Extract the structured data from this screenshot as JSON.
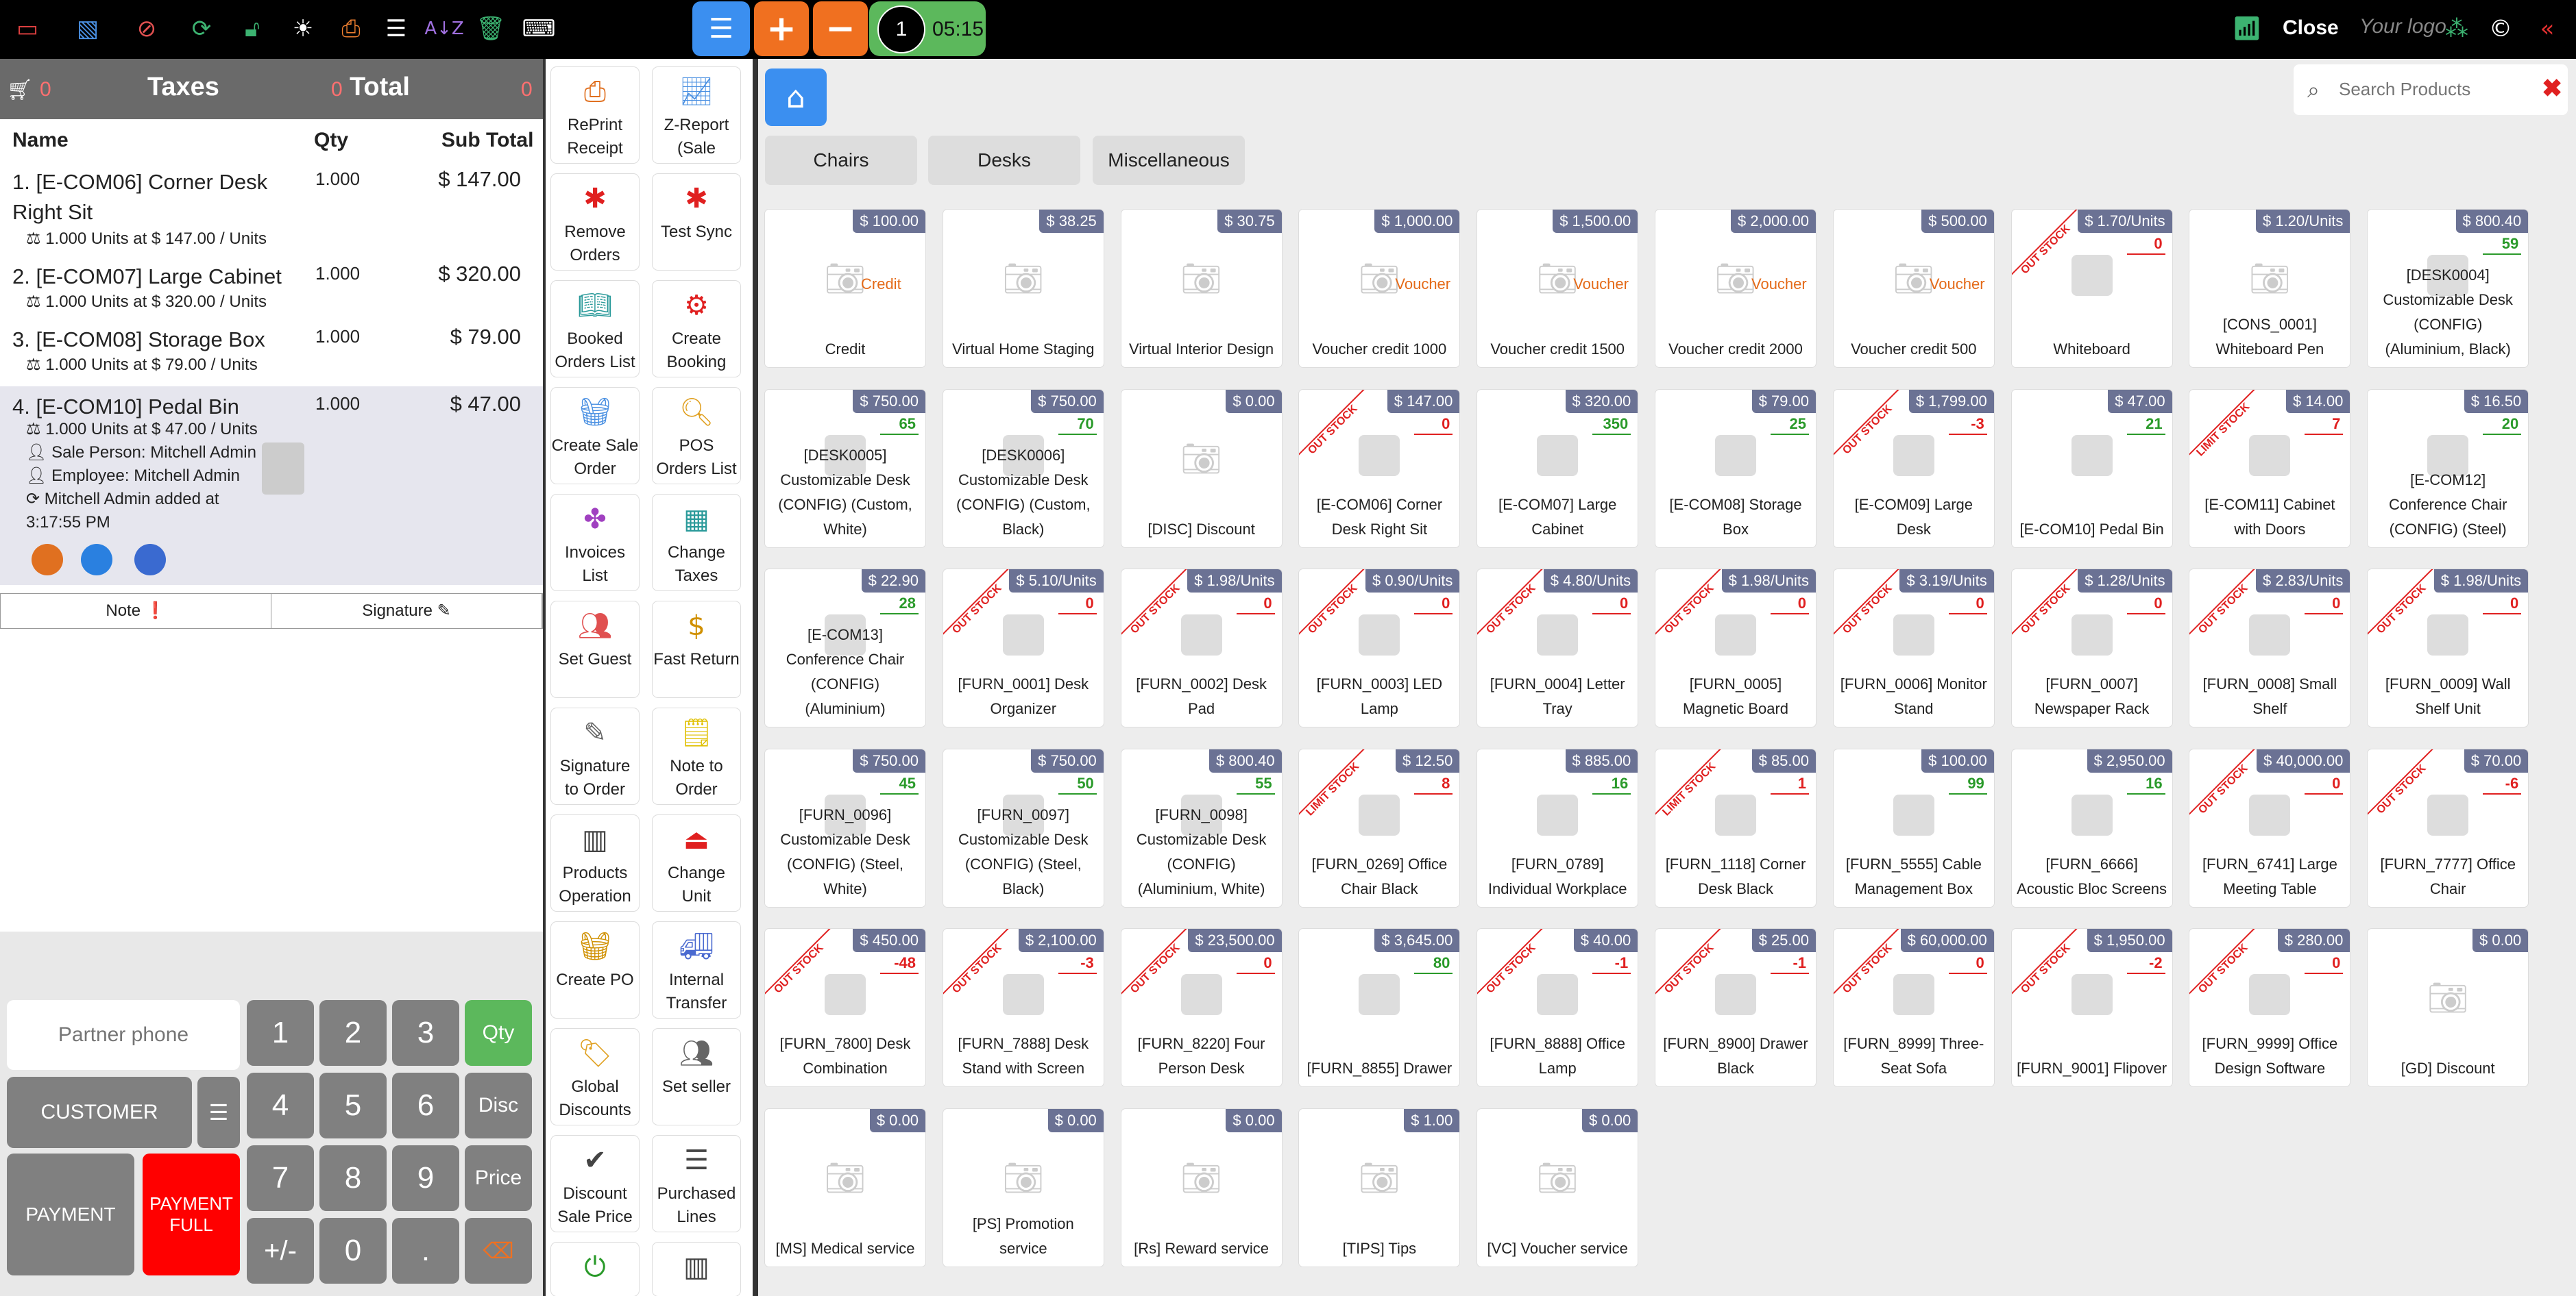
{
  "topbar": {
    "icons": [
      "monitor-icon",
      "image-icon",
      "cancel-icon",
      "refresh-icon",
      "unlock-icon",
      "bulb-icon",
      "print-icon",
      "list-icon",
      "sort-az-icon",
      "trash-icon",
      "keyboard-icon"
    ],
    "plus": "+",
    "minus": "−",
    "order_number": "1",
    "timer": "05:15",
    "close_label": "Close",
    "logo_text": "Your logo"
  },
  "order": {
    "header_taxes": "Taxes",
    "header_total": "Total",
    "header_zero": "0",
    "col_name": "Name",
    "col_qty": "Qty",
    "col_subtotal": "Sub Total",
    "lines": [
      {
        "name": "1. [E-COM06] Corner Desk Right Sit",
        "qty": "1.000",
        "subtotal": "$ 147.00",
        "detail": "1.000 Units at $ 147.00 / Units"
      },
      {
        "name": "2. [E-COM07] Large Cabinet",
        "qty": "1.000",
        "subtotal": "$ 320.00",
        "detail": "1.000 Units at $ 320.00 / Units"
      },
      {
        "name": "3. [E-COM08] Storage Box",
        "qty": "1.000",
        "subtotal": "$ 79.00",
        "detail": "1.000 Units at $ 79.00 / Units"
      },
      {
        "name": "4. [E-COM10] Pedal Bin",
        "qty": "1.000",
        "subtotal": "$ 47.00",
        "detail": "1.000 Units at $ 47.00 / Units",
        "sale_person": "Sale Person: Mitchell Admin",
        "employee": "Employee: Mitchell Admin",
        "added_by": "Mitchell Admin added at",
        "added_time": "3:17:55 PM"
      }
    ],
    "note_label": "Note",
    "signature_label": "Signature"
  },
  "keypad": {
    "partner_phone_placeholder": "Partner phone",
    "customer_label": "CUSTOMER",
    "payment_label": "PAYMENT",
    "payment_full_label": "PAYMENT FULL",
    "digits": [
      "1",
      "2",
      "3",
      "4",
      "5",
      "6",
      "7",
      "8",
      "9",
      "+/-",
      "0",
      "."
    ],
    "qty": "Qty",
    "disc": "Disc",
    "price": "Price"
  },
  "actions": [
    {
      "label": "RePrint Receipt",
      "icon": "printer-icon"
    },
    {
      "label": "Z-Report (Sale",
      "icon": "chart-icon"
    },
    {
      "label": "Remove Orders",
      "icon": "bug-icon"
    },
    {
      "label": "Test Sync",
      "icon": "bug-icon"
    },
    {
      "label": "Booked Orders List",
      "icon": "book-icon"
    },
    {
      "label": "Create Booking",
      "icon": "gear-icon"
    },
    {
      "label": "Create Sale Order",
      "icon": "basket-icon"
    },
    {
      "label": "POS Orders List",
      "icon": "search-icon"
    },
    {
      "label": "Invoices List",
      "icon": "puzzle-icon"
    },
    {
      "label": "Change Taxes",
      "icon": "calendar-icon"
    },
    {
      "label": "Set Guest",
      "icon": "people-icon"
    },
    {
      "label": "Fast Return",
      "icon": "coin-icon"
    },
    {
      "label": "Signature to Order",
      "icon": "pen-icon"
    },
    {
      "label": "Note to Order",
      "icon": "note-icon"
    },
    {
      "label": "Products Operation",
      "icon": "barcode-icon"
    },
    {
      "label": "Change Unit",
      "icon": "exit-icon"
    },
    {
      "label": "Create PO",
      "icon": "basket-icon"
    },
    {
      "label": "Internal Transfer",
      "icon": "truck-icon"
    },
    {
      "label": "Global Discounts",
      "icon": "tag-icon"
    },
    {
      "label": "Set seller",
      "icon": "people-icon"
    },
    {
      "label": "Discount Sale Price",
      "icon": "check-icon"
    },
    {
      "label": "Purchased Lines",
      "icon": "list-icon"
    }
  ],
  "products_area": {
    "search_placeholder": "Search Products",
    "categories": [
      "Chairs",
      "Desks",
      "Miscellaneous"
    ],
    "tag_credit": "Credit",
    "tag_voucher": "Voucher",
    "out_stock": "OUT STOCK",
    "limit_stock": "LIMIT STOCK",
    "products": [
      {
        "name": "Credit",
        "price": "$ 100.00",
        "tag": "Credit"
      },
      {
        "name": "Virtual Home Staging",
        "price": "$ 38.25"
      },
      {
        "name": "Virtual Interior Design",
        "price": "$ 30.75"
      },
      {
        "name": "Voucher credit 1000",
        "price": "$ 1,000.00",
        "tag": "Voucher"
      },
      {
        "name": "Voucher credit 1500",
        "price": "$ 1,500.00",
        "tag": "Voucher"
      },
      {
        "name": "Voucher credit 2000",
        "price": "$ 2,000.00",
        "tag": "Voucher"
      },
      {
        "name": "Voucher credit 500",
        "price": "$ 500.00",
        "tag": "Voucher"
      },
      {
        "name": "Whiteboard",
        "price": "$ 1.70/Units",
        "qty": "0",
        "stock": "out"
      },
      {
        "name": "[CONS_0001] Whiteboard Pen",
        "price": "$ 1.20/Units"
      },
      {
        "name": "[DESK0004] Customizable Desk (CONFIG) (Aluminium, Black)",
        "price": "$ 800.40",
        "qty": "59",
        "stock": "ok"
      },
      {
        "name": "[DESK0005] Customizable Desk (CONFIG) (Custom, White)",
        "price": "$ 750.00",
        "qty": "65",
        "stock": "ok"
      },
      {
        "name": "[DESK0006] Customizable Desk (CONFIG) (Custom, Black)",
        "price": "$ 750.00",
        "qty": "70",
        "stock": "ok"
      },
      {
        "name": "[DISC] Discount",
        "price": "$ 0.00"
      },
      {
        "name": "[E-COM06] Corner Desk Right Sit",
        "price": "$ 147.00",
        "qty": "0",
        "stock": "out"
      },
      {
        "name": "[E-COM07] Large Cabinet",
        "price": "$ 320.00",
        "qty": "350",
        "stock": "ok"
      },
      {
        "name": "[E-COM08] Storage Box",
        "price": "$ 79.00",
        "qty": "25",
        "stock": "ok"
      },
      {
        "name": "[E-COM09] Large Desk",
        "price": "$ 1,799.00",
        "qty": "-3",
        "stock": "out"
      },
      {
        "name": "[E-COM10] Pedal Bin",
        "price": "$ 47.00",
        "qty": "21",
        "stock": "ok"
      },
      {
        "name": "[E-COM11] Cabinet with Doors",
        "price": "$ 14.00",
        "qty": "7",
        "stock": "limit"
      },
      {
        "name": "[E-COM12] Conference Chair (CONFIG) (Steel)",
        "price": "$ 16.50",
        "qty": "20",
        "stock": "ok"
      },
      {
        "name": "[E-COM13] Conference Chair (CONFIG) (Aluminium)",
        "price": "$ 22.90",
        "qty": "28",
        "stock": "ok"
      },
      {
        "name": "[FURN_0001] Desk Organizer",
        "price": "$ 5.10/Units",
        "qty": "0",
        "stock": "out"
      },
      {
        "name": "[FURN_0002] Desk Pad",
        "price": "$ 1.98/Units",
        "qty": "0",
        "stock": "out"
      },
      {
        "name": "[FURN_0003] LED Lamp",
        "price": "$ 0.90/Units",
        "qty": "0",
        "stock": "out"
      },
      {
        "name": "[FURN_0004] Letter Tray",
        "price": "$ 4.80/Units",
        "qty": "0",
        "stock": "out"
      },
      {
        "name": "[FURN_0005] Magnetic Board",
        "price": "$ 1.98/Units",
        "qty": "0",
        "stock": "out"
      },
      {
        "name": "[FURN_0006] Monitor Stand",
        "price": "$ 3.19/Units",
        "qty": "0",
        "stock": "out"
      },
      {
        "name": "[FURN_0007] Newspaper Rack",
        "price": "$ 1.28/Units",
        "qty": "0",
        "stock": "out"
      },
      {
        "name": "[FURN_0008] Small Shelf",
        "price": "$ 2.83/Units",
        "qty": "0",
        "stock": "out"
      },
      {
        "name": "[FURN_0009] Wall Shelf Unit",
        "price": "$ 1.98/Units",
        "qty": "0",
        "stock": "out"
      },
      {
        "name": "[FURN_0096] Customizable Desk (CONFIG) (Steel, White)",
        "price": "$ 750.00",
        "qty": "45",
        "stock": "ok"
      },
      {
        "name": "[FURN_0097] Customizable Desk (CONFIG) (Steel, Black)",
        "price": "$ 750.00",
        "qty": "50",
        "stock": "ok"
      },
      {
        "name": "[FURN_0098] Customizable Desk (CONFIG) (Aluminium, White)",
        "price": "$ 800.40",
        "qty": "55",
        "stock": "ok"
      },
      {
        "name": "[FURN_0269] Office Chair Black",
        "price": "$ 12.50",
        "qty": "8",
        "stock": "limit"
      },
      {
        "name": "[FURN_0789] Individual Workplace",
        "price": "$ 885.00",
        "qty": "16",
        "stock": "ok"
      },
      {
        "name": "[FURN_1118] Corner Desk Black",
        "price": "$ 85.00",
        "qty": "1",
        "stock": "limit"
      },
      {
        "name": "[FURN_5555] Cable Management Box",
        "price": "$ 100.00",
        "qty": "99",
        "stock": "ok"
      },
      {
        "name": "[FURN_6666] Acoustic Bloc Screens",
        "price": "$ 2,950.00",
        "qty": "16",
        "stock": "ok"
      },
      {
        "name": "[FURN_6741] Large Meeting Table",
        "price": "$ 40,000.00",
        "qty": "0",
        "stock": "out"
      },
      {
        "name": "[FURN_7777] Office Chair",
        "price": "$ 70.00",
        "qty": "-6",
        "stock": "out"
      },
      {
        "name": "[FURN_7800] Desk Combination",
        "price": "$ 450.00",
        "qty": "-48",
        "stock": "out"
      },
      {
        "name": "[FURN_7888] Desk Stand with Screen",
        "price": "$ 2,100.00",
        "qty": "-3",
        "stock": "out"
      },
      {
        "name": "[FURN_8220] Four Person Desk",
        "price": "$ 23,500.00",
        "qty": "0",
        "stock": "out"
      },
      {
        "name": "[FURN_8855] Drawer",
        "price": "$ 3,645.00",
        "qty": "80",
        "stock": "ok"
      },
      {
        "name": "[FURN_8888] Office Lamp",
        "price": "$ 40.00",
        "qty": "-1",
        "stock": "out"
      },
      {
        "name": "[FURN_8900] Drawer Black",
        "price": "$ 25.00",
        "qty": "-1",
        "stock": "out"
      },
      {
        "name": "[FURN_8999] Three-Seat Sofa",
        "price": "$ 60,000.00",
        "qty": "0",
        "stock": "out"
      },
      {
        "name": "[FURN_9001] Flipover",
        "price": "$ 1,950.00",
        "qty": "-2",
        "stock": "out"
      },
      {
        "name": "[FURN_9999] Office Design Software",
        "price": "$ 280.00",
        "qty": "0",
        "stock": "out"
      },
      {
        "name": "[GD] Discount",
        "price": "$ 0.00"
      },
      {
        "name": "[MS] Medical service",
        "price": "$ 0.00"
      },
      {
        "name": "[PS] Promotion service",
        "price": "$ 0.00"
      },
      {
        "name": "[Rs] Reward service",
        "price": "$ 0.00"
      },
      {
        "name": "[TIPS] Tips",
        "price": "$ 1.00"
      },
      {
        "name": "[VC] Voucher service",
        "price": "$ 0.00"
      }
    ]
  }
}
